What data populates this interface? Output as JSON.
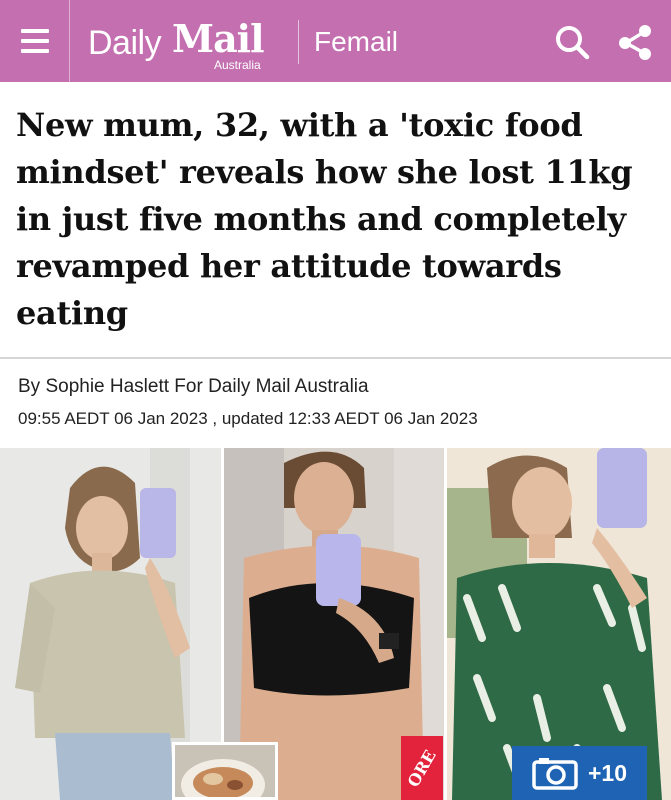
{
  "header": {
    "logo_daily": "Daily",
    "logo_mail": "Mail",
    "logo_region": "Australia",
    "section": "Femail"
  },
  "article": {
    "headline": "New mum, 32, with a 'toxic food mindset' reveals how she lost 11kg in just five months and completely revamped her attitude towards eating",
    "byline": "By Sophie Haslett For Daily Mail Australia",
    "dateline": "09:55 AEDT 06 Jan 2023 , updated 12:33 AEDT 06 Jan 2023"
  },
  "gallery": {
    "count_label": "+10",
    "more_badge": "ORE"
  },
  "colors": {
    "header_bg": "#c36fb0",
    "gallery_button": "#1f63b4",
    "badge_red": "#e2233b"
  }
}
